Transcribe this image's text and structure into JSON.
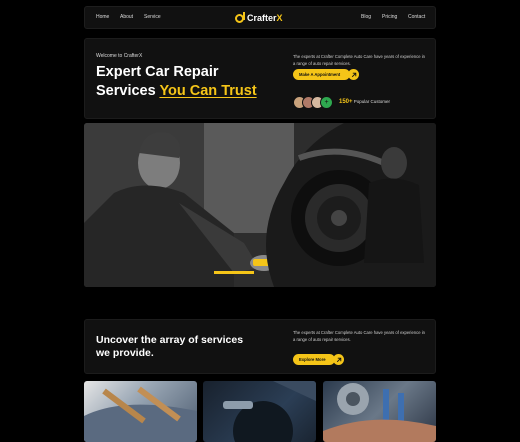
{
  "nav": {
    "left_links": [
      "Home",
      "About",
      "Service"
    ],
    "logo_text": "Crafter",
    "logo_accent": "X",
    "right_links": [
      "Blog",
      "Pricing",
      "Contact"
    ]
  },
  "hero": {
    "welcome": "Welcome to CrafterX",
    "headline_line1": "Expert Car Repair",
    "headline_line2": "Services ",
    "headline_highlight": "You Can Trust",
    "description": "The experts at Crafter Complete Auto Care have years of experience in a range of auto repair services.",
    "cta_label": "Make A Appointment",
    "customers_count": "150+",
    "customers_label": "Popular Customer"
  },
  "services": {
    "title": "Uncover the array of services we provide.",
    "description": "The experts at Crafter Complete Auto Care have years of experience in a range of auto repair services.",
    "cta_label": "Explore More"
  },
  "colors": {
    "accent": "#f5c518",
    "background": "#000000",
    "panel": "#111111"
  },
  "icons": {
    "cta_arrow": "arrow-up-right-icon",
    "logo": "crafter-logo-icon"
  }
}
